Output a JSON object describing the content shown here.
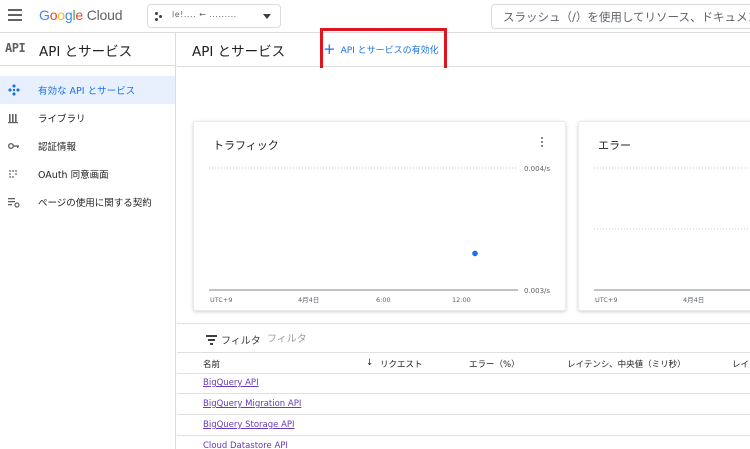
{
  "topbar": {
    "brand_google": [
      "G",
      "o",
      "o",
      "g",
      "l",
      "e"
    ],
    "brand_cloud": "Cloud",
    "project_name": "le!.... ←         .........",
    "search_placeholder": "スラッシュ（/）を使用してリソース、ドキュメント"
  },
  "sidebar": {
    "badge": "API",
    "title": "API とサービス",
    "items": [
      {
        "label": "有効な API とサービス",
        "icon": "api-diamond-icon",
        "active": true
      },
      {
        "label": "ライブラリ",
        "icon": "library-icon",
        "active": false
      },
      {
        "label": "認証情報",
        "icon": "key-icon",
        "active": false
      },
      {
        "label": "OAuth 同意画面",
        "icon": "consent-dots-icon",
        "active": false
      },
      {
        "label": "ページの使用に関する契約",
        "icon": "settings-list-icon",
        "active": false
      }
    ]
  },
  "main": {
    "title": "API とサービス",
    "enable_button_label": "API とサービスの有効化",
    "annotation_color": "#e0141e"
  },
  "chart_data": [
    {
      "type": "scatter",
      "title": "トラフィック",
      "x_ticks": [
        "UTC+9",
        "4月4日",
        "6:00",
        "12:00"
      ],
      "y_ticks": [
        "0.004/s",
        "0.003/s"
      ],
      "ylim": [
        0.003,
        0.004
      ],
      "series": [
        {
          "values": [
            0.0033
          ],
          "x": [
            "13:30"
          ]
        }
      ],
      "grid": true
    },
    {
      "type": "line",
      "title": "エラー",
      "x_ticks": [
        "UTC+9",
        "4月4日"
      ],
      "series": [],
      "grid": true
    }
  ],
  "filter": {
    "label": "フィルタ",
    "placeholder": "フィルタ"
  },
  "table": {
    "columns": [
      "名前",
      "リクエスト",
      "エラー（%）",
      "レイテンシ、中央値（ミリ秒）",
      "レイ"
    ],
    "rows": [
      "BigQuery API",
      "BigQuery Migration API",
      "BigQuery Storage API",
      "Cloud Datastore API"
    ]
  }
}
